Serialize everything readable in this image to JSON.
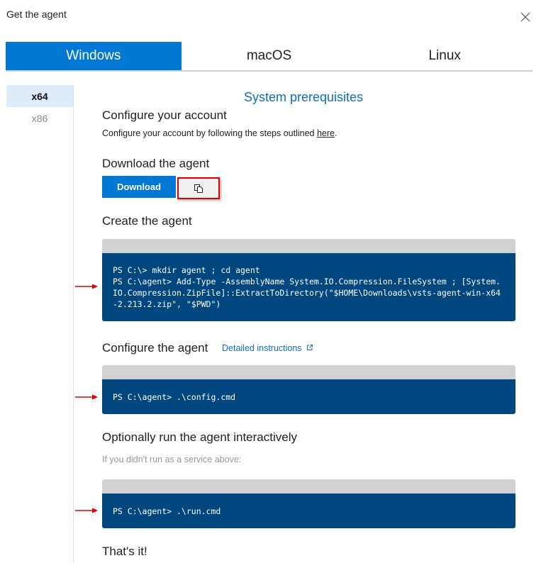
{
  "dialog": {
    "title": "Get the agent",
    "close_icon": "close-icon"
  },
  "os_tabs": [
    {
      "label": "Windows",
      "active": true
    },
    {
      "label": "macOS",
      "active": false
    },
    {
      "label": "Linux",
      "active": false
    }
  ],
  "arch": [
    {
      "label": "x64",
      "active": true
    },
    {
      "label": "x86",
      "active": false
    }
  ],
  "prereq_link": "System prerequisites",
  "sections": {
    "configure_account": {
      "heading": "Configure your account",
      "text_before": "Configure your account by following the steps outlined ",
      "link": "here",
      "text_after": "."
    },
    "download": {
      "heading": "Download the agent",
      "button": "Download",
      "copy_icon": "copy-icon"
    },
    "create": {
      "heading": "Create the agent",
      "code": "PS C:\\> mkdir agent ; cd agent\nPS C:\\agent> Add-Type -AssemblyName System.IO.Compression.FileSystem ; [System.IO.Compression.ZipFile]::ExtractToDirectory(\"$HOME\\Downloads\\vsts-agent-win-x64-2.213.2.zip\", \"$PWD\")"
    },
    "configure_agent": {
      "heading": "Configure the agent",
      "link": "Detailed instructions",
      "code": "PS C:\\agent> .\\config.cmd"
    },
    "run": {
      "heading": "Optionally run the agent interactively",
      "note": "If you didn't run as a service above:",
      "code": "PS C:\\agent> .\\run.cmd"
    },
    "done": {
      "heading": "That's it!"
    }
  },
  "colors": {
    "accent": "#0078d4",
    "code_bg": "#00467f",
    "code_header": "#d2d2d2",
    "highlight_box": "#e00000",
    "annotation_arrow": "#e00000"
  }
}
